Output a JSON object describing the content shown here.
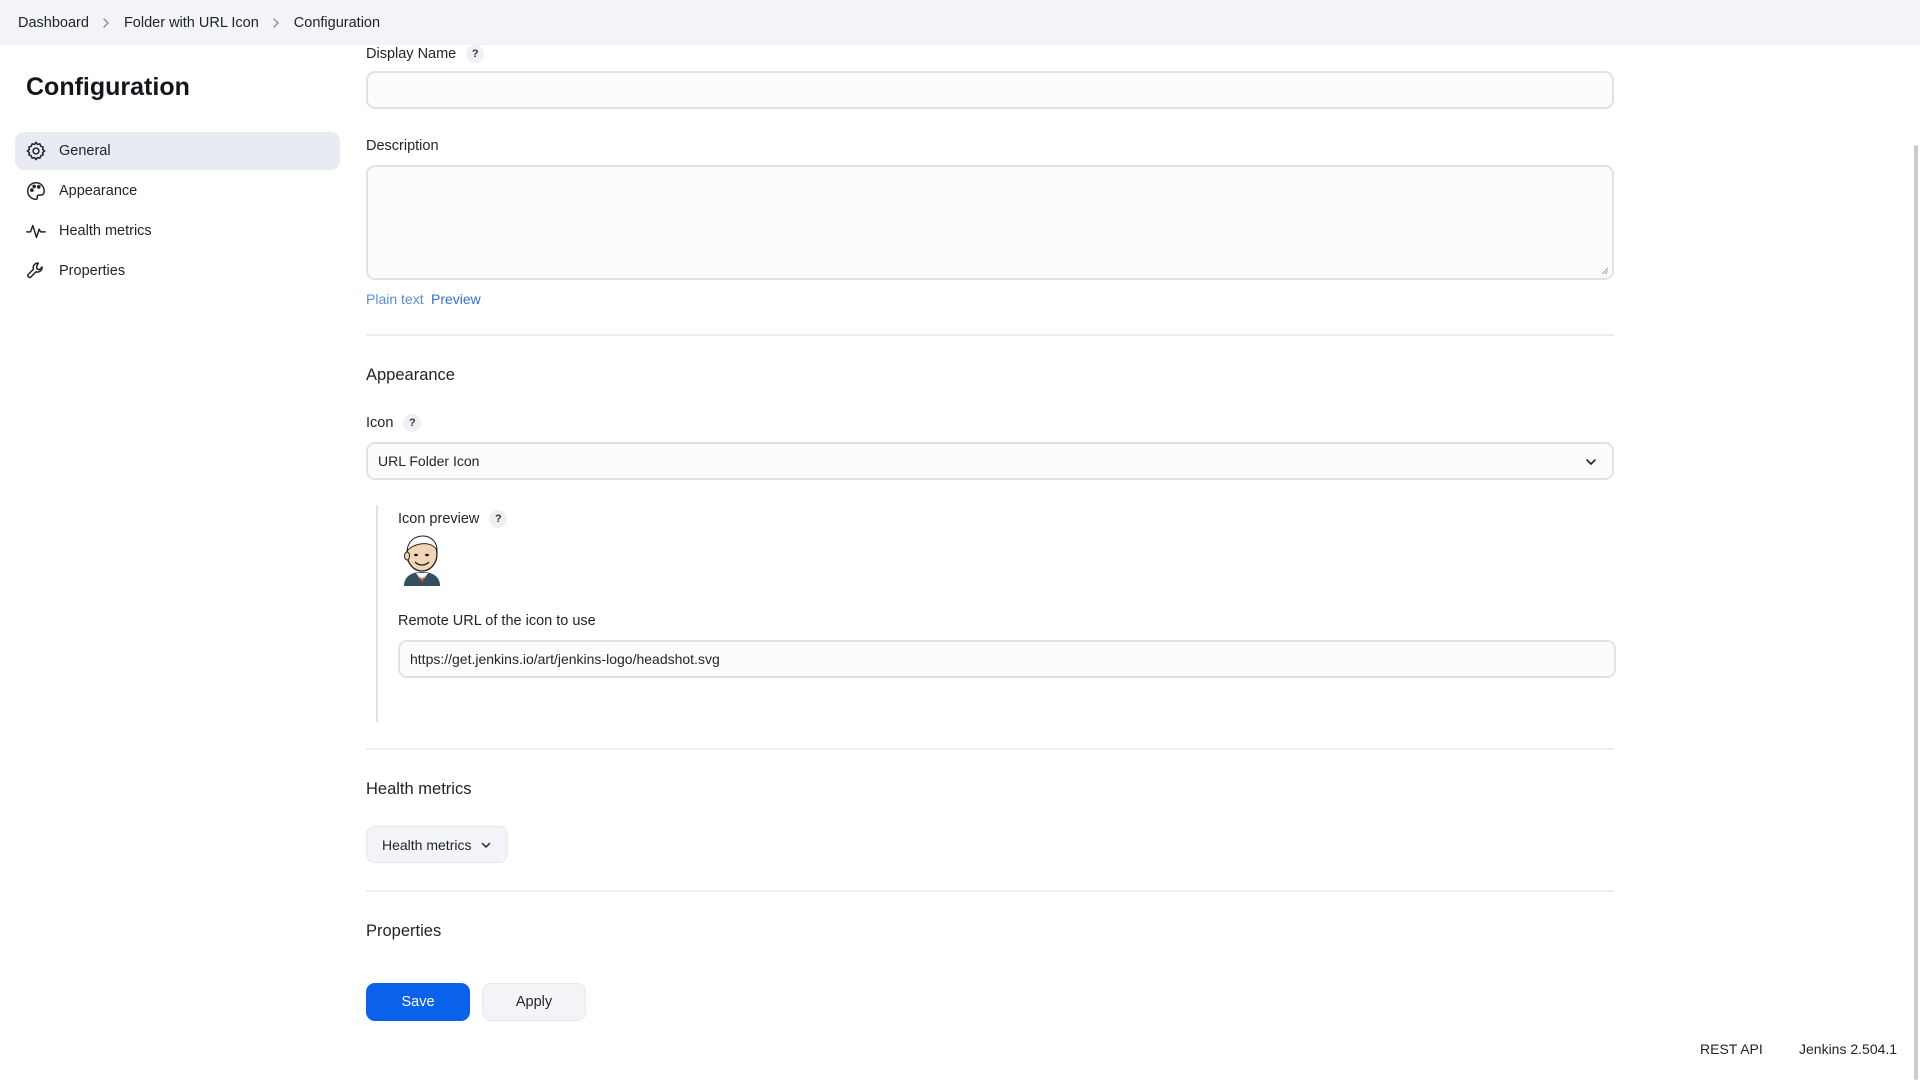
{
  "breadcrumb": {
    "items": [
      "Dashboard",
      "Folder with URL Icon",
      "Configuration"
    ]
  },
  "sidebar": {
    "title": "Configuration",
    "items": [
      {
        "label": "General",
        "icon": "gear-icon",
        "active": true
      },
      {
        "label": "Appearance",
        "icon": "palette-icon",
        "active": false
      },
      {
        "label": "Health metrics",
        "icon": "pulse-icon",
        "active": false
      },
      {
        "label": "Properties",
        "icon": "wrench-icon",
        "active": false
      }
    ]
  },
  "general": {
    "display_name_label": "Display Name",
    "display_name_value": "",
    "description_label": "Description",
    "description_value": "",
    "plain_text_label": "Plain text",
    "preview_label": "Preview",
    "help_glyph": "?"
  },
  "appearance": {
    "section_title": "Appearance",
    "icon_label": "Icon",
    "icon_selected": "URL Folder Icon",
    "icon_preview_label": "Icon preview",
    "remote_url_label": "Remote URL of the icon to use",
    "remote_url_value": "https://get.jenkins.io/art/jenkins-logo/headshot.svg"
  },
  "health_metrics": {
    "section_title": "Health metrics",
    "button_label": "Health metrics"
  },
  "properties": {
    "section_title": "Properties"
  },
  "actions": {
    "save_label": "Save",
    "apply_label": "Apply"
  },
  "footer": {
    "rest_api": "REST API",
    "version": "Jenkins 2.504.1"
  },
  "colors": {
    "accent": "#0b62ea",
    "link": "#3b7bd5",
    "topbar_bg": "#f2f4f7",
    "active_nav_bg": "#e8ecf2"
  }
}
